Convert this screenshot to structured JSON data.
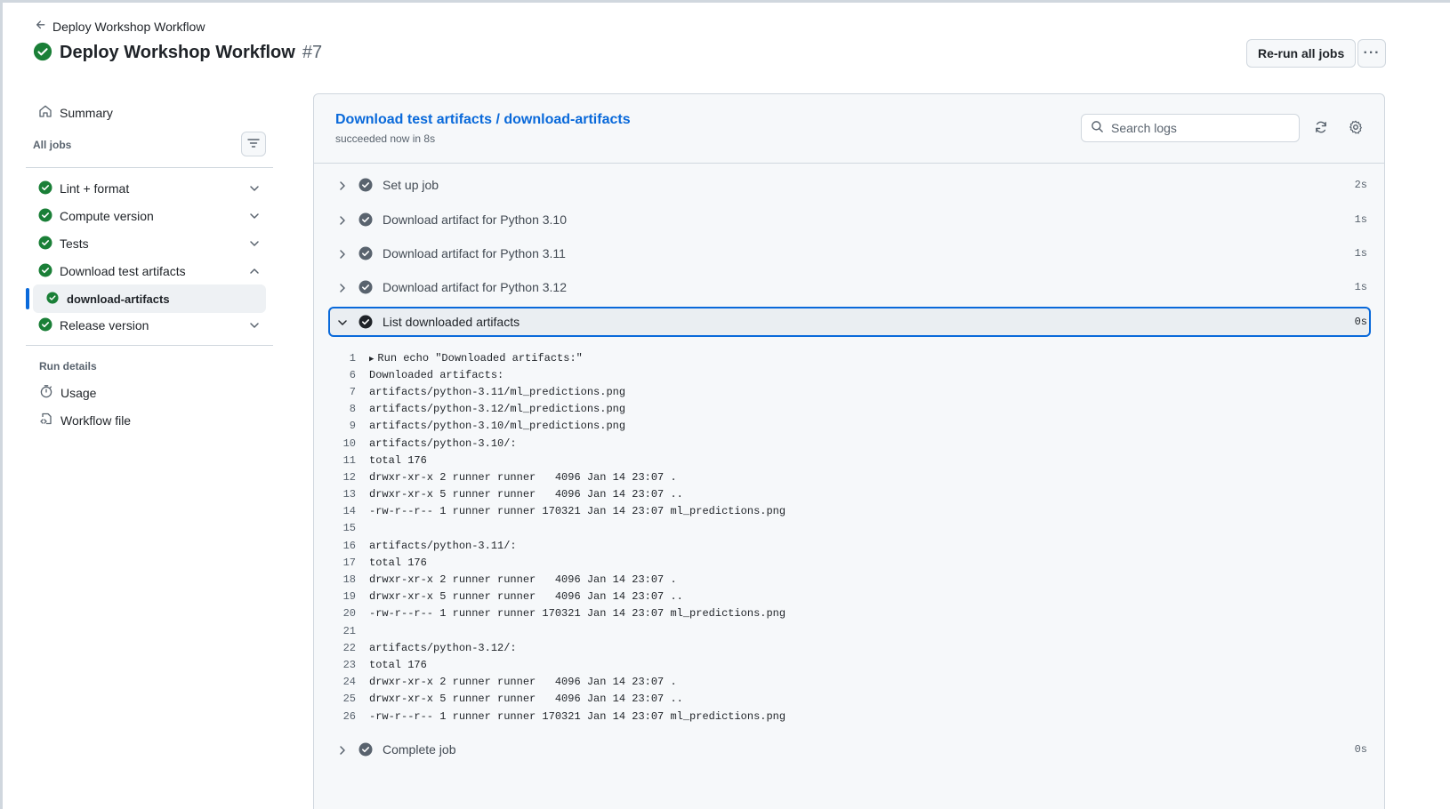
{
  "header": {
    "back_label": "Deploy Workshop Workflow",
    "title": "Deploy Workshop Workflow",
    "run_number": "#7",
    "rerun_label": "Re-run all jobs",
    "more_label": "···"
  },
  "sidebar": {
    "summary_label": "Summary",
    "all_jobs_label": "All jobs",
    "jobs": [
      {
        "label": "Lint + format",
        "status": "success",
        "expanded": false
      },
      {
        "label": "Compute version",
        "status": "success",
        "expanded": false
      },
      {
        "label": "Tests",
        "status": "success",
        "expanded": false
      },
      {
        "label": "Download test artifacts",
        "status": "success",
        "expanded": true
      },
      {
        "label": "Release version",
        "status": "success",
        "expanded": false
      }
    ],
    "active_subjob": "download-artifacts",
    "run_details_label": "Run details",
    "usage_label": "Usage",
    "workflow_file_label": "Workflow file"
  },
  "job": {
    "title": "Download test artifacts / download-artifacts",
    "subtitle": "succeeded now in 8s",
    "search_placeholder": "Search logs",
    "steps": [
      {
        "name": "Set up job",
        "time": "2s"
      },
      {
        "name": "Download artifact for Python 3.10",
        "time": "1s"
      },
      {
        "name": "Download artifact for Python 3.11",
        "time": "1s"
      },
      {
        "name": "Download artifact for Python 3.12",
        "time": "1s"
      },
      {
        "name": "List downloaded artifacts",
        "time": "0s",
        "expanded": true
      },
      {
        "name": "Complete job",
        "time": "0s"
      }
    ],
    "log_lines": [
      {
        "n": "1",
        "text": "Run echo \"Downloaded artifacts:\"",
        "collapsible": true
      },
      {
        "n": "6",
        "text": "Downloaded artifacts:"
      },
      {
        "n": "7",
        "text": "artifacts/python-3.11/ml_predictions.png"
      },
      {
        "n": "8",
        "text": "artifacts/python-3.12/ml_predictions.png"
      },
      {
        "n": "9",
        "text": "artifacts/python-3.10/ml_predictions.png"
      },
      {
        "n": "10",
        "text": "artifacts/python-3.10/:"
      },
      {
        "n": "11",
        "text": "total 176"
      },
      {
        "n": "12",
        "text": "drwxr-xr-x 2 runner runner   4096 Jan 14 23:07 ."
      },
      {
        "n": "13",
        "text": "drwxr-xr-x 5 runner runner   4096 Jan 14 23:07 .."
      },
      {
        "n": "14",
        "text": "-rw-r--r-- 1 runner runner 170321 Jan 14 23:07 ml_predictions.png"
      },
      {
        "n": "15",
        "text": ""
      },
      {
        "n": "16",
        "text": "artifacts/python-3.11/:"
      },
      {
        "n": "17",
        "text": "total 176"
      },
      {
        "n": "18",
        "text": "drwxr-xr-x 2 runner runner   4096 Jan 14 23:07 ."
      },
      {
        "n": "19",
        "text": "drwxr-xr-x 5 runner runner   4096 Jan 14 23:07 .."
      },
      {
        "n": "20",
        "text": "-rw-r--r-- 1 runner runner 170321 Jan 14 23:07 ml_predictions.png"
      },
      {
        "n": "21",
        "text": ""
      },
      {
        "n": "22",
        "text": "artifacts/python-3.12/:"
      },
      {
        "n": "23",
        "text": "total 176"
      },
      {
        "n": "24",
        "text": "drwxr-xr-x 2 runner runner   4096 Jan 14 23:07 ."
      },
      {
        "n": "25",
        "text": "drwxr-xr-x 5 runner runner   4096 Jan 14 23:07 .."
      },
      {
        "n": "26",
        "text": "-rw-r--r-- 1 runner runner 170321 Jan 14 23:07 ml_predictions.png"
      }
    ]
  },
  "colors": {
    "success": "#1a7f37",
    "step_done": "#59636e",
    "step_active": "#1f2328",
    "accent": "#0969da"
  },
  "icons": {
    "back": "arrow-left-icon",
    "status": "check-circle-fill-icon",
    "summary": "home-icon",
    "filter": "filter-icon",
    "usage": "stopwatch-icon",
    "workflow_file": "file-code-icon",
    "search": "search-icon",
    "refresh": "sync-icon",
    "settings": "gear-icon",
    "expand": "chevron-right-icon",
    "collapse": "chevron-down-icon"
  }
}
